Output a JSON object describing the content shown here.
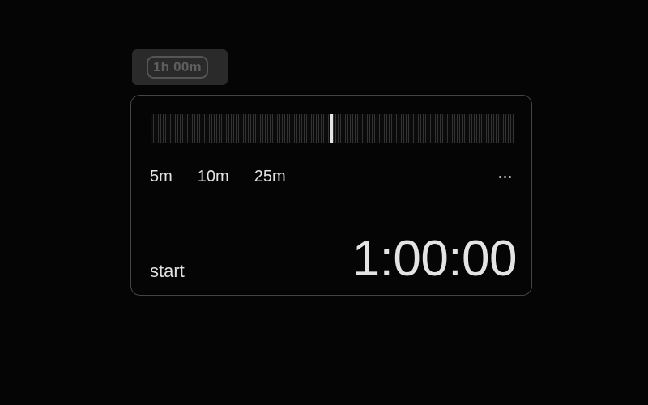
{
  "duration_chip": {
    "label": "1h 00m"
  },
  "timer": {
    "presets": [
      {
        "label": "5m"
      },
      {
        "label": "10m"
      },
      {
        "label": "25m"
      }
    ],
    "more_menu_icon": "ellipsis-icon",
    "start_label": "start",
    "time_display": "1:00:00"
  },
  "colors": {
    "background": "#050505",
    "card_border": "#444444",
    "chip_background": "#2a2a2a",
    "text_primary": "#e4e4e4",
    "text_muted": "#5e5e5e",
    "ruler_tick": "#333333",
    "needle": "#e6e6e6"
  }
}
